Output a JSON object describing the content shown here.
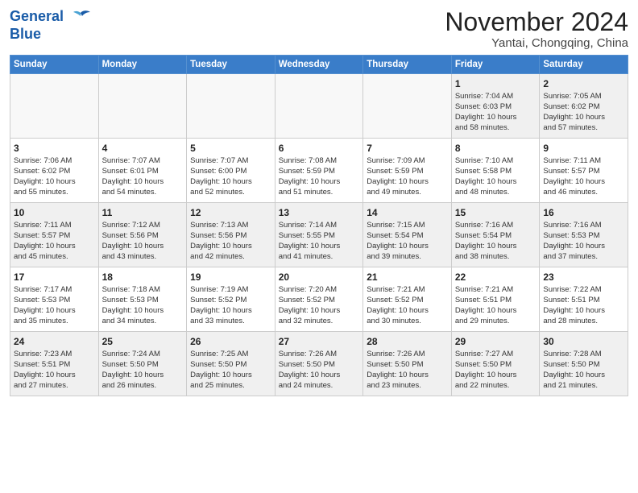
{
  "header": {
    "logo_line1": "General",
    "logo_line2": "Blue",
    "month": "November 2024",
    "location": "Yantai, Chongqing, China"
  },
  "days_of_week": [
    "Sunday",
    "Monday",
    "Tuesday",
    "Wednesday",
    "Thursday",
    "Friday",
    "Saturday"
  ],
  "weeks": [
    [
      {
        "day": "",
        "info": ""
      },
      {
        "day": "",
        "info": ""
      },
      {
        "day": "",
        "info": ""
      },
      {
        "day": "",
        "info": ""
      },
      {
        "day": "",
        "info": ""
      },
      {
        "day": "1",
        "info": "Sunrise: 7:04 AM\nSunset: 6:03 PM\nDaylight: 10 hours\nand 58 minutes."
      },
      {
        "day": "2",
        "info": "Sunrise: 7:05 AM\nSunset: 6:02 PM\nDaylight: 10 hours\nand 57 minutes."
      }
    ],
    [
      {
        "day": "3",
        "info": "Sunrise: 7:06 AM\nSunset: 6:02 PM\nDaylight: 10 hours\nand 55 minutes."
      },
      {
        "day": "4",
        "info": "Sunrise: 7:07 AM\nSunset: 6:01 PM\nDaylight: 10 hours\nand 54 minutes."
      },
      {
        "day": "5",
        "info": "Sunrise: 7:07 AM\nSunset: 6:00 PM\nDaylight: 10 hours\nand 52 minutes."
      },
      {
        "day": "6",
        "info": "Sunrise: 7:08 AM\nSunset: 5:59 PM\nDaylight: 10 hours\nand 51 minutes."
      },
      {
        "day": "7",
        "info": "Sunrise: 7:09 AM\nSunset: 5:59 PM\nDaylight: 10 hours\nand 49 minutes."
      },
      {
        "day": "8",
        "info": "Sunrise: 7:10 AM\nSunset: 5:58 PM\nDaylight: 10 hours\nand 48 minutes."
      },
      {
        "day": "9",
        "info": "Sunrise: 7:11 AM\nSunset: 5:57 PM\nDaylight: 10 hours\nand 46 minutes."
      }
    ],
    [
      {
        "day": "10",
        "info": "Sunrise: 7:11 AM\nSunset: 5:57 PM\nDaylight: 10 hours\nand 45 minutes."
      },
      {
        "day": "11",
        "info": "Sunrise: 7:12 AM\nSunset: 5:56 PM\nDaylight: 10 hours\nand 43 minutes."
      },
      {
        "day": "12",
        "info": "Sunrise: 7:13 AM\nSunset: 5:56 PM\nDaylight: 10 hours\nand 42 minutes."
      },
      {
        "day": "13",
        "info": "Sunrise: 7:14 AM\nSunset: 5:55 PM\nDaylight: 10 hours\nand 41 minutes."
      },
      {
        "day": "14",
        "info": "Sunrise: 7:15 AM\nSunset: 5:54 PM\nDaylight: 10 hours\nand 39 minutes."
      },
      {
        "day": "15",
        "info": "Sunrise: 7:16 AM\nSunset: 5:54 PM\nDaylight: 10 hours\nand 38 minutes."
      },
      {
        "day": "16",
        "info": "Sunrise: 7:16 AM\nSunset: 5:53 PM\nDaylight: 10 hours\nand 37 minutes."
      }
    ],
    [
      {
        "day": "17",
        "info": "Sunrise: 7:17 AM\nSunset: 5:53 PM\nDaylight: 10 hours\nand 35 minutes."
      },
      {
        "day": "18",
        "info": "Sunrise: 7:18 AM\nSunset: 5:53 PM\nDaylight: 10 hours\nand 34 minutes."
      },
      {
        "day": "19",
        "info": "Sunrise: 7:19 AM\nSunset: 5:52 PM\nDaylight: 10 hours\nand 33 minutes."
      },
      {
        "day": "20",
        "info": "Sunrise: 7:20 AM\nSunset: 5:52 PM\nDaylight: 10 hours\nand 32 minutes."
      },
      {
        "day": "21",
        "info": "Sunrise: 7:21 AM\nSunset: 5:52 PM\nDaylight: 10 hours\nand 30 minutes."
      },
      {
        "day": "22",
        "info": "Sunrise: 7:21 AM\nSunset: 5:51 PM\nDaylight: 10 hours\nand 29 minutes."
      },
      {
        "day": "23",
        "info": "Sunrise: 7:22 AM\nSunset: 5:51 PM\nDaylight: 10 hours\nand 28 minutes."
      }
    ],
    [
      {
        "day": "24",
        "info": "Sunrise: 7:23 AM\nSunset: 5:51 PM\nDaylight: 10 hours\nand 27 minutes."
      },
      {
        "day": "25",
        "info": "Sunrise: 7:24 AM\nSunset: 5:50 PM\nDaylight: 10 hours\nand 26 minutes."
      },
      {
        "day": "26",
        "info": "Sunrise: 7:25 AM\nSunset: 5:50 PM\nDaylight: 10 hours\nand 25 minutes."
      },
      {
        "day": "27",
        "info": "Sunrise: 7:26 AM\nSunset: 5:50 PM\nDaylight: 10 hours\nand 24 minutes."
      },
      {
        "day": "28",
        "info": "Sunrise: 7:26 AM\nSunset: 5:50 PM\nDaylight: 10 hours\nand 23 minutes."
      },
      {
        "day": "29",
        "info": "Sunrise: 7:27 AM\nSunset: 5:50 PM\nDaylight: 10 hours\nand 22 minutes."
      },
      {
        "day": "30",
        "info": "Sunrise: 7:28 AM\nSunset: 5:50 PM\nDaylight: 10 hours\nand 21 minutes."
      }
    ]
  ]
}
